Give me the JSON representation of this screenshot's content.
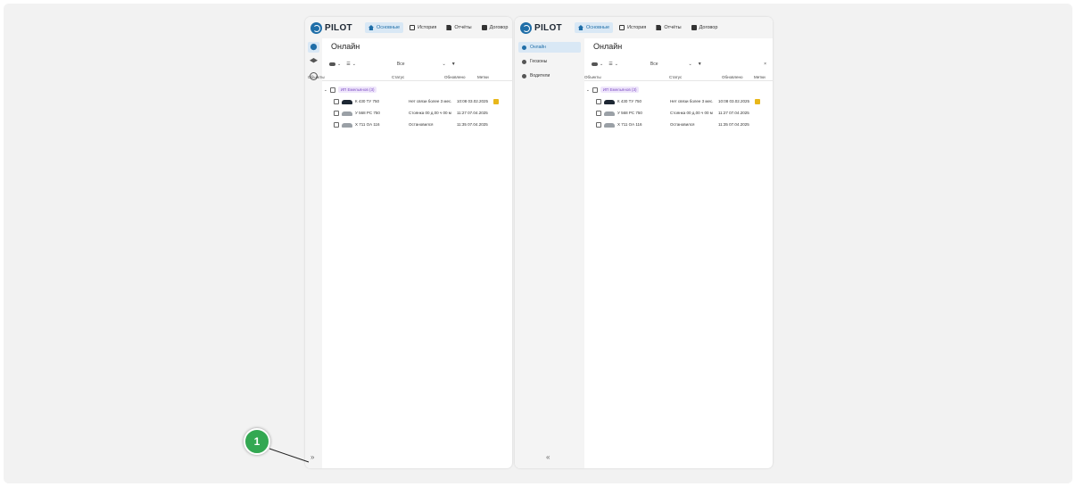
{
  "app": {
    "logo_text": "PILOT",
    "tabs": [
      {
        "label": "Основные",
        "icon": "home-icon",
        "active": true
      },
      {
        "label": "История",
        "icon": "route-icon",
        "active": false
      },
      {
        "label": "Отчёты",
        "icon": "report-icon",
        "active": false
      },
      {
        "label": "Договор",
        "icon": "contract-icon",
        "active": false
      }
    ]
  },
  "sidebar": {
    "items": [
      {
        "label": "Онлайн",
        "icon": "location-pin-icon",
        "active": true
      },
      {
        "label": "Геозоны",
        "icon": "layers-icon",
        "active": false
      },
      {
        "label": "Водители",
        "icon": "steering-wheel-icon",
        "active": false
      }
    ],
    "expand_glyph": "»",
    "collapse_glyph": "«"
  },
  "main": {
    "title": "Онлайн",
    "filter_select_value": "Все",
    "clear_glyph": "×",
    "columns": [
      "Объекты",
      "Статус",
      "Обновлено",
      "Метки"
    ],
    "group": {
      "label": "ИП Емельянов (3)"
    },
    "rows": [
      {
        "plate": "К 430 ТУ 750",
        "status": "Нет связи более 3 мес.",
        "updated": "10:08 03.02.2025",
        "car": "dark",
        "has_tag": true
      },
      {
        "plate": "У 568 РС 750",
        "status": "Стоянка 00 д.00 ч 00 м",
        "updated": "11:27 07.04.2025",
        "car": "grey",
        "has_tag": false
      },
      {
        "plate": "Х 711 ОА 116",
        "status": "Остановился",
        "updated": "11:35 07.04.2025",
        "car": "grey",
        "has_tag": false
      }
    ]
  },
  "annotation": {
    "number": "1"
  },
  "colors": {
    "accent": "#1f6ea8",
    "callout": "#33a852",
    "tag_bg": "#efe6fb",
    "badge": "#e8b71a"
  }
}
